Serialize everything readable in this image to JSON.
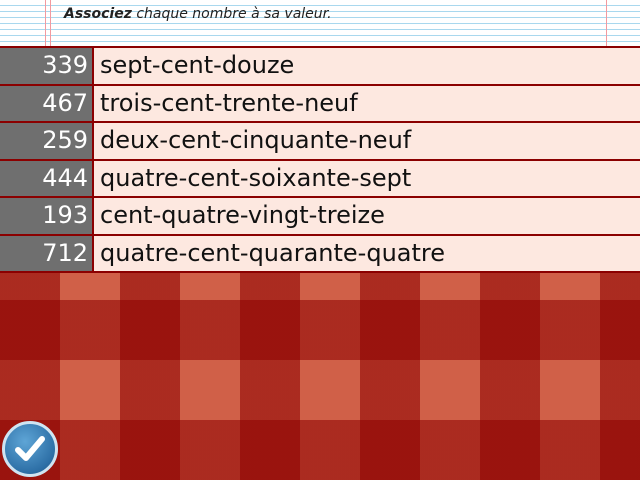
{
  "instruction": {
    "bold": "Associez",
    "rest": " chaque nombre à sa valeur."
  },
  "rows": [
    {
      "number": "339",
      "words": "sept-cent-douze"
    },
    {
      "number": "467",
      "words": "trois-cent-trente-neuf"
    },
    {
      "number": "259",
      "words": "deux-cent-cinquante-neuf"
    },
    {
      "number": "444",
      "words": "quatre-cent-soixante-sept"
    },
    {
      "number": "193",
      "words": "cent-quatre-vingt-treize"
    },
    {
      "number": "712",
      "words": "quatre-cent-quarante-quatre"
    }
  ],
  "colors": {
    "row_border": "#8b0000",
    "number_bg": "#6f6f6f",
    "word_bg": "#fde8e0",
    "button_blue": "#2d6fa6"
  },
  "icons": {
    "validate": "checkmark-icon"
  }
}
